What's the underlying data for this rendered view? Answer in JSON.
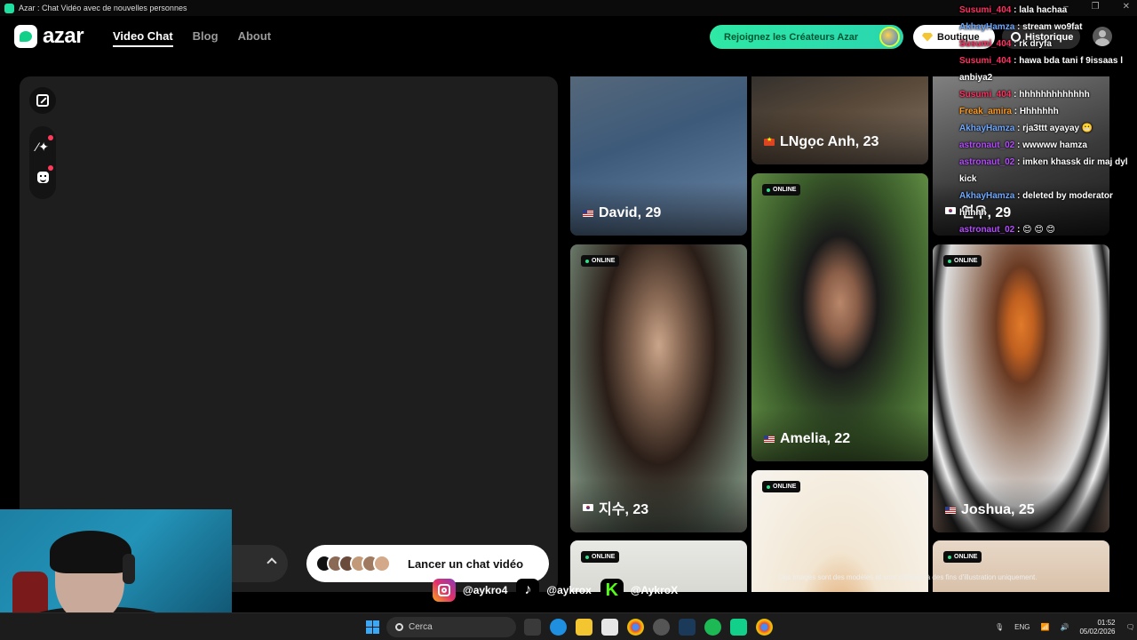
{
  "window": {
    "title": "Azar : Chat Vidéo avec de nouvelles personnes"
  },
  "header": {
    "logo_text": "azar",
    "nav": [
      {
        "label": "Video Chat",
        "active": true
      },
      {
        "label": "Blog",
        "active": false
      },
      {
        "label": "About",
        "active": false
      }
    ],
    "creators_label": "Rejoignez les Créateurs Azar",
    "boutique_label": "Boutique",
    "historique_label": "Historique"
  },
  "start": {
    "label": "Lancer un chat vidéo"
  },
  "cards": [
    {
      "name": "David, 29",
      "flag": "us",
      "online": false
    },
    {
      "name": "LNgọc Anh, 23",
      "flag": "vn",
      "online": false
    },
    {
      "name": "연우, 29",
      "flag": "kr",
      "online": false
    },
    {
      "name": "지수, 23",
      "flag": "kr",
      "online": true
    },
    {
      "name": "Amelia, 22",
      "flag": "us",
      "online": true
    },
    {
      "name": "Joshua, 25",
      "flag": "us",
      "online": true
    },
    {
      "name": "",
      "flag": "",
      "online": true
    },
    {
      "name": "",
      "flag": "",
      "online": true
    },
    {
      "name": "",
      "flag": "",
      "online": true
    }
  ],
  "online_label": "ONLINE",
  "disclaimer": "Ces images sont des modèles et sont utilisées à des fins d'illustration uniquement.",
  "chat": [
    {
      "user": "Susumi_404",
      "color": "#ff3060",
      "msg": ": lala hachaa"
    },
    {
      "user": "AkhayHamza",
      "color": "#6fa8ff",
      "msg": ": stream wo9fat"
    },
    {
      "user": "Susumi_404",
      "color": "#ff3060",
      "msg": ": rk dryfa"
    },
    {
      "user": "Susumi_404",
      "color": "#ff3060",
      "msg": ": hawa bda tani f 9issaas l anbiya2"
    },
    {
      "user": "Susumi_404",
      "color": "#ff3060",
      "msg": ": hhhhhhhhhhhhh"
    },
    {
      "user": "Freak_amira",
      "color": "#ff9a1f",
      "msg": ": Hhhhhhh"
    },
    {
      "user": "AkhayHamza",
      "color": "#6fa8ff",
      "msg": ": rja3ttt ayayay 😬"
    },
    {
      "user": "astronaut_02",
      "color": "#b54cff",
      "msg": ": wwwww hamza"
    },
    {
      "user": "astronaut_02",
      "color": "#b54cff",
      "msg": ": imken khassk dir maj dyl kick"
    },
    {
      "user": "AkhayHamza",
      "color": "#6fa8ff",
      "msg": ": deleted by moderator hhhhh"
    },
    {
      "user": "astronaut_02",
      "color": "#b54cff",
      "msg": ": 😊 😊 😊"
    }
  ],
  "socials": [
    {
      "handle": "@aykro4",
      "icon": "instagram-icon"
    },
    {
      "handle": "@aykrox",
      "icon": "tiktok-icon"
    },
    {
      "handle": "@AykroX",
      "icon": "kick-icon"
    }
  ],
  "taskbar": {
    "search_placeholder": "Cerca",
    "lang": "ENG",
    "time": "01:52",
    "date": "05/02/2026"
  }
}
